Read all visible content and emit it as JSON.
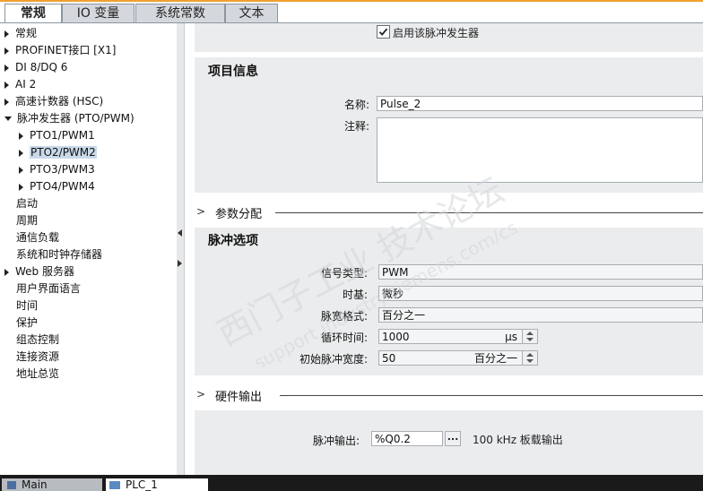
{
  "tabs": [
    {
      "label": "常规",
      "active": true
    },
    {
      "label": "IO 变量",
      "active": false
    },
    {
      "label": "系统常数",
      "active": false
    },
    {
      "label": "文本",
      "active": false
    }
  ],
  "tree": {
    "items": [
      {
        "label": "常规",
        "level": 0,
        "arrow": "right"
      },
      {
        "label": "PROFINET接口 [X1]",
        "level": 0,
        "arrow": "right"
      },
      {
        "label": "DI 8/DQ 6",
        "level": 0,
        "arrow": "right"
      },
      {
        "label": "AI 2",
        "level": 0,
        "arrow": "right"
      },
      {
        "label": "高速计数器 (HSC)",
        "level": 0,
        "arrow": "right"
      },
      {
        "label": "脉冲发生器 (PTO/PWM)",
        "level": 0,
        "arrow": "down"
      },
      {
        "label": "PTO1/PWM1",
        "level": 1,
        "arrow": "right"
      },
      {
        "label": "PTO2/PWM2",
        "level": 1,
        "arrow": "right",
        "selected": true
      },
      {
        "label": "PTO3/PWM3",
        "level": 1,
        "arrow": "right"
      },
      {
        "label": "PTO4/PWM4",
        "level": 1,
        "arrow": "right"
      },
      {
        "label": "启动",
        "level": 0,
        "arrow": "none"
      },
      {
        "label": "周期",
        "level": 0,
        "arrow": "none"
      },
      {
        "label": "通信负载",
        "level": 0,
        "arrow": "none"
      },
      {
        "label": "系统和时钟存储器",
        "level": 0,
        "arrow": "none"
      },
      {
        "label": "Web 服务器",
        "level": 0,
        "arrow": "right"
      },
      {
        "label": "用户界面语言",
        "level": 0,
        "arrow": "none"
      },
      {
        "label": "时间",
        "level": 0,
        "arrow": "none"
      },
      {
        "label": "保护",
        "level": 0,
        "arrow": "none"
      },
      {
        "label": "组态控制",
        "level": 0,
        "arrow": "none"
      },
      {
        "label": "连接资源",
        "level": 0,
        "arrow": "none"
      },
      {
        "label": "地址总览",
        "level": 0,
        "arrow": "none"
      }
    ]
  },
  "enable": {
    "label": "启用该脉冲发生器",
    "checked": true
  },
  "project_info": {
    "title": "项目信息",
    "name_label": "名称:",
    "name_value": "Pulse_2",
    "comment_label": "注释:",
    "comment_value": ""
  },
  "param_section": {
    "label": "参数分配"
  },
  "pulse_options": {
    "title": "脉冲选项",
    "signal_type_label": "信号类型:",
    "signal_type_value": "PWM",
    "time_base_label": "时基:",
    "time_base_value": "微秒",
    "pulse_width_format_label": "脉宽格式:",
    "pulse_width_format_value": "百分之一",
    "cycle_time_label": "循环时间:",
    "cycle_time_value": "1000",
    "cycle_time_unit": "µs",
    "initial_width_label": "初始脉冲宽度:",
    "initial_width_value": "50",
    "initial_width_unit": "百分之一"
  },
  "hardware_section": {
    "label": "硬件输出"
  },
  "pulse_output": {
    "label": "脉冲输出:",
    "value": "%Q0.2",
    "browse_label": "...",
    "note": "100 kHz 板载输出"
  },
  "taskbar": {
    "items": [
      {
        "label": "Main"
      },
      {
        "label": "PLC_1"
      }
    ]
  },
  "watermark": {
    "line1": "西门子工业  技术论坛",
    "line2": "support.industry.siemens.com/cs"
  },
  "colors": {
    "accent": "#f0a030",
    "panel": "#ebeced",
    "selected": "#c9d9ea"
  }
}
